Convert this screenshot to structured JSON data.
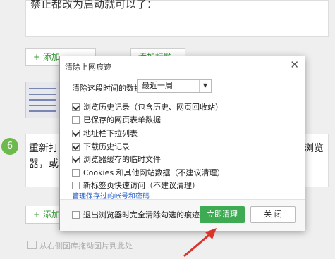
{
  "background": {
    "top_text": "禁止都改为启动就可以了：",
    "add_button_1": "+ 添加",
    "add_button_1b": "添加标题",
    "step_number": "6",
    "step_text_1": "重新打开",
    "step_text_2": "器，或者",
    "step_text_3": "换个浏览",
    "add_button_2": "+ 添加",
    "drop_hint": "从右侧图库拖动图片到此处"
  },
  "dialog": {
    "title": "清除上网痕迹",
    "close_glyph": "✕",
    "time_label": "清除这段时间的数据：",
    "time_value": "最近一周",
    "options": [
      {
        "label": "浏览历史记录（包含历史、网页回收站）",
        "checked": true
      },
      {
        "label": "已保存的网页表单数据",
        "checked": false
      },
      {
        "label": "地址栏下拉列表",
        "checked": true
      },
      {
        "label": "下载历史记录",
        "checked": true
      },
      {
        "label": "浏览器缓存的临时文件",
        "checked": true
      },
      {
        "label": "Cookies 和其他网站数据（不建议清理）",
        "checked": false
      },
      {
        "label": "新标签页快速访问（不建议清理）",
        "checked": false
      }
    ],
    "manage_link": "管理保存过的帐号和密码",
    "exit_checkbox_label": "退出浏览器时完全清除勾选的痕迹",
    "exit_checked": false,
    "clean_button": "立即清理",
    "close_button": "关 闭"
  },
  "colors": {
    "accent_green": "#3eaa53",
    "link_blue": "#2a62c9",
    "arrow_red": "#d9332b"
  }
}
